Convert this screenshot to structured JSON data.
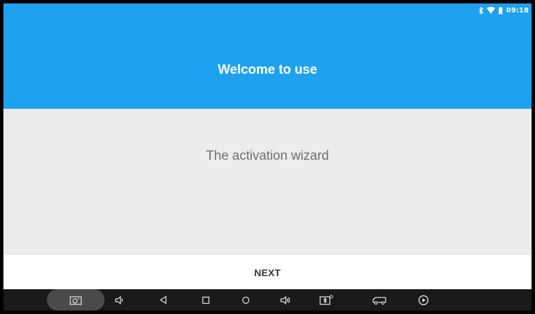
{
  "status_bar": {
    "time": "09:18",
    "icons": [
      "bluetooth-icon",
      "wifi-icon",
      "battery-icon"
    ]
  },
  "header": {
    "title": "Welcome to use",
    "background_color": "#1ea2ef"
  },
  "content": {
    "subtitle": "The activation wizard"
  },
  "footer": {
    "next_label": "NEXT"
  },
  "navbar": {
    "buttons": [
      "screenshot-icon",
      "volume-down-icon",
      "back-icon",
      "recents-icon",
      "home-icon",
      "volume-up-icon",
      "bluetooth-device-icon",
      "vehicle-icon",
      "play-icon"
    ]
  }
}
